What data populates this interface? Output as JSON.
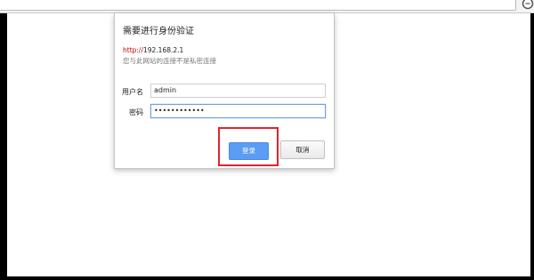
{
  "dialog": {
    "title": "需要进行身份验证",
    "url_scheme": "http://",
    "url_host": "192.168.2.1",
    "warning": "您与此网站的连接不是私密连接",
    "username_label": "用户名",
    "username_value": "admin",
    "password_label": "密码",
    "password_value": "••••••••••••",
    "login_label": "登录",
    "cancel_label": "取消"
  },
  "icons": {
    "browser_menu": "menu-circle-icon"
  },
  "colors": {
    "login_button": "#5b9cf5",
    "highlight_box": "#e0242d",
    "focus_border": "#6d9fe6"
  }
}
